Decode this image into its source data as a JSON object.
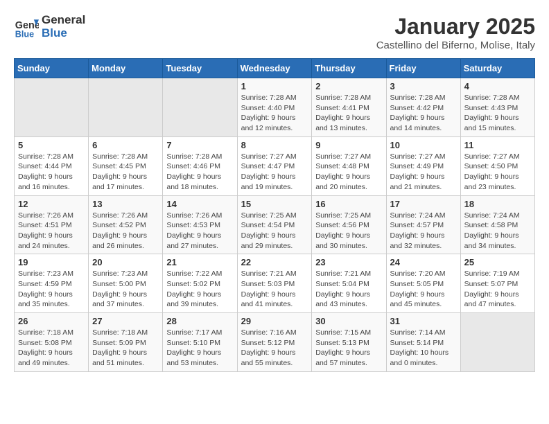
{
  "header": {
    "logo_line1": "General",
    "logo_line2": "Blue",
    "month": "January 2025",
    "location": "Castellino del Biferno, Molise, Italy"
  },
  "weekdays": [
    "Sunday",
    "Monday",
    "Tuesday",
    "Wednesday",
    "Thursday",
    "Friday",
    "Saturday"
  ],
  "weeks": [
    [
      {
        "day": "",
        "info": ""
      },
      {
        "day": "",
        "info": ""
      },
      {
        "day": "",
        "info": ""
      },
      {
        "day": "1",
        "info": "Sunrise: 7:28 AM\nSunset: 4:40 PM\nDaylight: 9 hours\nand 12 minutes."
      },
      {
        "day": "2",
        "info": "Sunrise: 7:28 AM\nSunset: 4:41 PM\nDaylight: 9 hours\nand 13 minutes."
      },
      {
        "day": "3",
        "info": "Sunrise: 7:28 AM\nSunset: 4:42 PM\nDaylight: 9 hours\nand 14 minutes."
      },
      {
        "day": "4",
        "info": "Sunrise: 7:28 AM\nSunset: 4:43 PM\nDaylight: 9 hours\nand 15 minutes."
      }
    ],
    [
      {
        "day": "5",
        "info": "Sunrise: 7:28 AM\nSunset: 4:44 PM\nDaylight: 9 hours\nand 16 minutes."
      },
      {
        "day": "6",
        "info": "Sunrise: 7:28 AM\nSunset: 4:45 PM\nDaylight: 9 hours\nand 17 minutes."
      },
      {
        "day": "7",
        "info": "Sunrise: 7:28 AM\nSunset: 4:46 PM\nDaylight: 9 hours\nand 18 minutes."
      },
      {
        "day": "8",
        "info": "Sunrise: 7:27 AM\nSunset: 4:47 PM\nDaylight: 9 hours\nand 19 minutes."
      },
      {
        "day": "9",
        "info": "Sunrise: 7:27 AM\nSunset: 4:48 PM\nDaylight: 9 hours\nand 20 minutes."
      },
      {
        "day": "10",
        "info": "Sunrise: 7:27 AM\nSunset: 4:49 PM\nDaylight: 9 hours\nand 21 minutes."
      },
      {
        "day": "11",
        "info": "Sunrise: 7:27 AM\nSunset: 4:50 PM\nDaylight: 9 hours\nand 23 minutes."
      }
    ],
    [
      {
        "day": "12",
        "info": "Sunrise: 7:26 AM\nSunset: 4:51 PM\nDaylight: 9 hours\nand 24 minutes."
      },
      {
        "day": "13",
        "info": "Sunrise: 7:26 AM\nSunset: 4:52 PM\nDaylight: 9 hours\nand 26 minutes."
      },
      {
        "day": "14",
        "info": "Sunrise: 7:26 AM\nSunset: 4:53 PM\nDaylight: 9 hours\nand 27 minutes."
      },
      {
        "day": "15",
        "info": "Sunrise: 7:25 AM\nSunset: 4:54 PM\nDaylight: 9 hours\nand 29 minutes."
      },
      {
        "day": "16",
        "info": "Sunrise: 7:25 AM\nSunset: 4:56 PM\nDaylight: 9 hours\nand 30 minutes."
      },
      {
        "day": "17",
        "info": "Sunrise: 7:24 AM\nSunset: 4:57 PM\nDaylight: 9 hours\nand 32 minutes."
      },
      {
        "day": "18",
        "info": "Sunrise: 7:24 AM\nSunset: 4:58 PM\nDaylight: 9 hours\nand 34 minutes."
      }
    ],
    [
      {
        "day": "19",
        "info": "Sunrise: 7:23 AM\nSunset: 4:59 PM\nDaylight: 9 hours\nand 35 minutes."
      },
      {
        "day": "20",
        "info": "Sunrise: 7:23 AM\nSunset: 5:00 PM\nDaylight: 9 hours\nand 37 minutes."
      },
      {
        "day": "21",
        "info": "Sunrise: 7:22 AM\nSunset: 5:02 PM\nDaylight: 9 hours\nand 39 minutes."
      },
      {
        "day": "22",
        "info": "Sunrise: 7:21 AM\nSunset: 5:03 PM\nDaylight: 9 hours\nand 41 minutes."
      },
      {
        "day": "23",
        "info": "Sunrise: 7:21 AM\nSunset: 5:04 PM\nDaylight: 9 hours\nand 43 minutes."
      },
      {
        "day": "24",
        "info": "Sunrise: 7:20 AM\nSunset: 5:05 PM\nDaylight: 9 hours\nand 45 minutes."
      },
      {
        "day": "25",
        "info": "Sunrise: 7:19 AM\nSunset: 5:07 PM\nDaylight: 9 hours\nand 47 minutes."
      }
    ],
    [
      {
        "day": "26",
        "info": "Sunrise: 7:18 AM\nSunset: 5:08 PM\nDaylight: 9 hours\nand 49 minutes."
      },
      {
        "day": "27",
        "info": "Sunrise: 7:18 AM\nSunset: 5:09 PM\nDaylight: 9 hours\nand 51 minutes."
      },
      {
        "day": "28",
        "info": "Sunrise: 7:17 AM\nSunset: 5:10 PM\nDaylight: 9 hours\nand 53 minutes."
      },
      {
        "day": "29",
        "info": "Sunrise: 7:16 AM\nSunset: 5:12 PM\nDaylight: 9 hours\nand 55 minutes."
      },
      {
        "day": "30",
        "info": "Sunrise: 7:15 AM\nSunset: 5:13 PM\nDaylight: 9 hours\nand 57 minutes."
      },
      {
        "day": "31",
        "info": "Sunrise: 7:14 AM\nSunset: 5:14 PM\nDaylight: 10 hours\nand 0 minutes."
      },
      {
        "day": "",
        "info": ""
      }
    ]
  ]
}
